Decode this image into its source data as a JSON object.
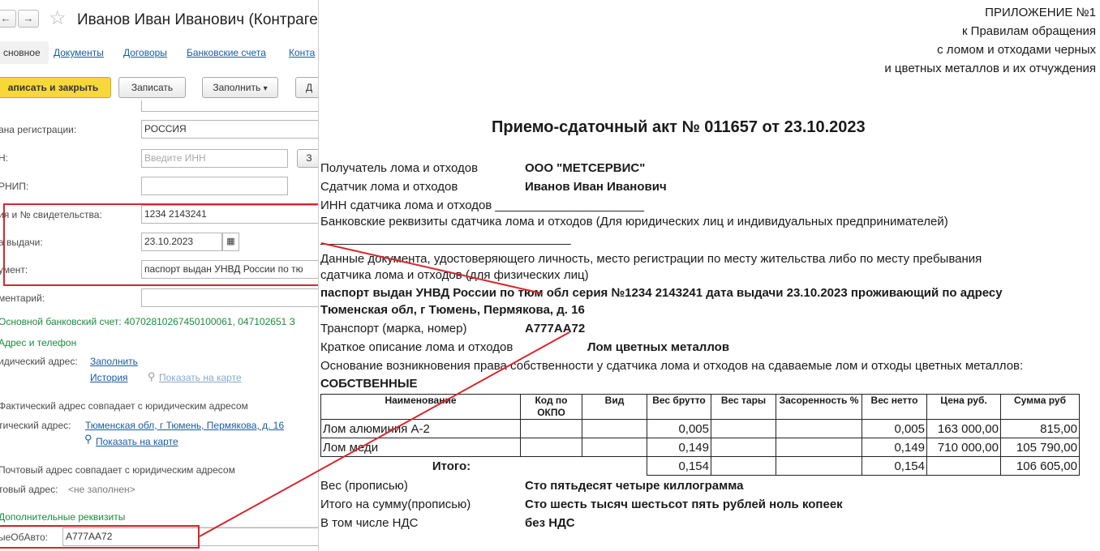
{
  "form": {
    "nav_back": "←",
    "nav_forward": "→",
    "title": "Иванов Иван Иванович (Контраге",
    "tabs": [
      "сновное",
      "Документы",
      "Договоры",
      "Банковские счета",
      "Конта"
    ],
    "buttons": {
      "save_close": "аписать и закрыть",
      "save": "Записать",
      "fill": "Заполнить",
      "fill_arrow": "▾",
      "more": "Д"
    },
    "fields": {
      "country_label": "ана регистрации:",
      "country_value": "РОССИЯ",
      "inn_label": "Н:",
      "inn_placeholder": "Введите ИНН",
      "inn_button": "З",
      "ogrnip_label": "РНИП:",
      "cert_label": "ия и № свидетельства:",
      "cert_value": "1234 2143241",
      "issue_label": "а выдачи:",
      "issue_value": "23.10.2023",
      "doc_label": "умент:",
      "doc_value": "паспорт выдан УНВД России по тю",
      "comment_label": "ментарий:"
    },
    "bank_line": "Основной банковский счет: 40702810267450100061, 047102651 З",
    "address_section": "Адрес и телефон",
    "legal_address_label": "идический адрес:",
    "fill_link": "Заполнить",
    "history_link": "История",
    "show_on_map": "Показать на карте",
    "actual_same_text": "Фактический адрес совпадает с юридическим адресом",
    "actual_address_label": "тический адрес:",
    "actual_address_value": "Тюменская обл, г Тюмень, Пермякова, д. 16",
    "show_on_map2": "Показать на карте",
    "postal_same_text": "Почтовый адрес совпадает с юридическим адресом",
    "postal_label": "товый адрес:",
    "postal_value": "<не заполнен>",
    "extra_section": "Дополнительные реквизиты",
    "auto_label": "ыеОбАвто:",
    "auto_value": "А777АА72"
  },
  "document": {
    "appendix": [
      "ПРИЛОЖЕНИЕ №1",
      "к Правилам обращения",
      "с ломом и отходами черных",
      "и цветных металлов и их отчуждения"
    ],
    "title": "Приемо-сдаточный акт № 011657 от 23.10.2023",
    "receiver_label": "Получатель лома и отходов",
    "receiver_value": "ООО \"МЕТСЕРВИС\"",
    "supplier_label": "Сдатчик лома и отходов",
    "supplier_value": "Иванов Иван Иванович",
    "inn_line": "ИНН сдатчика лома и отходов ______________________",
    "bank_line": "Банковские реквизиты сдатчика лома и отходов (Для юридических лиц и индивидуальных предпринимателей)",
    "bank_blank": "_____________________________________",
    "id_doc_line1": "Данные документа, удостоверяющего личность, место регистрации по месту жительства либо по месту пребывания",
    "id_doc_line2": "сдатчика лома и отходов (для физических лиц)",
    "id_doc_value1": "паспорт выдан УНВД России по тюм обл серия №1234 2143241 дата выдачи 23.10.2023 проживающий по адресу",
    "id_doc_value2": "Тюменская обл, г Тюмень, Пермякова, д. 16",
    "transport_label": "Транспорт (марка, номер)",
    "transport_value": "А777АА72",
    "desc_label": "Краткое описание лома и отходов",
    "desc_value": "Лом цветных металлов",
    "basis_label": "Основание возникновения права собственности у сдатчика лома и отходов на сдаваемые лом и отходы цветных металлов:",
    "basis_value": "СОБСТВЕННЫЕ",
    "table": {
      "headers": [
        "Наименование",
        "Код по ОКПО",
        "Вид",
        "Вес брутто",
        "Вес тары",
        "Засоренность %",
        "Вес нетто",
        "Цена руб.",
        "Сумма руб"
      ],
      "rows": [
        [
          "Лом алюминия А-2",
          "",
          "",
          "0,005",
          "",
          "",
          "0,005",
          "163 000,00",
          "815,00"
        ],
        [
          "Лом меди",
          "",
          "",
          "0,149",
          "",
          "",
          "0,149",
          "710 000,00",
          "105 790,00"
        ]
      ],
      "total_label": "Итого:",
      "total_gross": "0,154",
      "total_net": "0,154",
      "total_sum": "106 605,00"
    },
    "weight_words_label": "Вес (прописью)",
    "weight_words_value": "Сто пятьдесят четыре киллограмма",
    "sum_words_label": "Итого на сумму(прописью)",
    "sum_words_value": "Сто шесть тысяч шестьсот пять рублей ноль копеек",
    "vat_label": "В том числе НДС",
    "vat_value": "без НДС"
  },
  "colors": {
    "highlight": "#d7262c",
    "primary_button": "#f6d83b",
    "link": "#1a5aa6",
    "section_green": "#1c8a3e"
  }
}
